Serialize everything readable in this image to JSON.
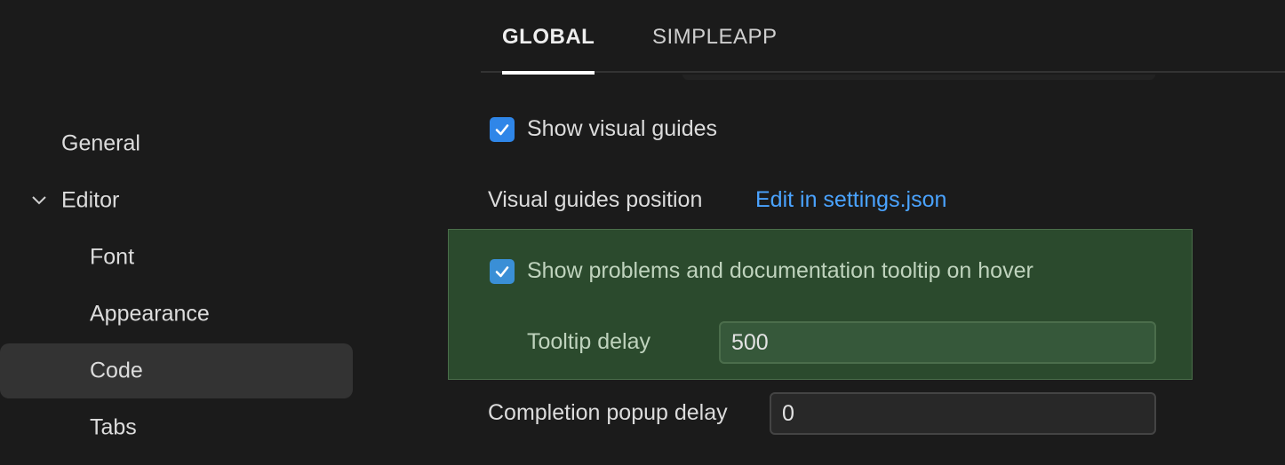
{
  "sidebar": {
    "items": [
      {
        "label": "General"
      },
      {
        "label": "Editor"
      },
      {
        "label": "Font"
      },
      {
        "label": "Appearance"
      },
      {
        "label": "Code"
      },
      {
        "label": "Tabs"
      }
    ]
  },
  "tabs": [
    {
      "label": "GLOBAL"
    },
    {
      "label": "SIMPLEAPP"
    }
  ],
  "settings": {
    "show_visual_guides": {
      "label": "Show visual guides",
      "checked": true
    },
    "visual_guides_position": {
      "label": "Visual guides position",
      "link": "Edit in settings.json"
    },
    "show_tooltip": {
      "label": "Show problems and documentation tooltip on hover",
      "checked": true
    },
    "tooltip_delay": {
      "label": "Tooltip delay",
      "value": "500"
    },
    "completion_popup_delay": {
      "label": "Completion popup delay",
      "value": "0"
    }
  },
  "colors": {
    "accent": "#2f86e8",
    "link": "#4aa3ff",
    "highlight_bg": "#2b4a2d"
  }
}
